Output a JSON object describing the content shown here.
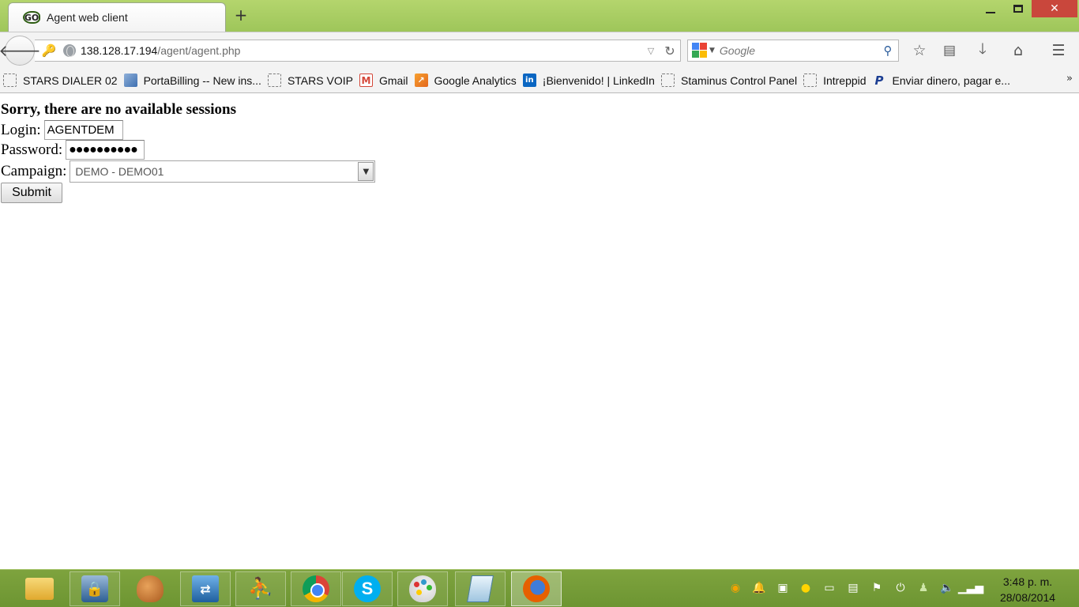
{
  "browser": {
    "tab_title": "Agent web client",
    "favicon_text": "GO",
    "new_tab_symbol": "+",
    "url_host": "138.128.17.194",
    "url_path": "/agent/agent.php",
    "search_placeholder": "Google",
    "window_close_symbol": "✕"
  },
  "bookmarks": [
    {
      "label": "STARS DIALER 02",
      "icon": "blank-page-icon"
    },
    {
      "label": "PortaBilling -- New ins...",
      "icon": "portabilling-icon"
    },
    {
      "label": "STARS VOIP",
      "icon": "blank-page-icon"
    },
    {
      "label": "Gmail",
      "icon": "gmail-icon"
    },
    {
      "label": "Google Analytics",
      "icon": "google-analytics-icon"
    },
    {
      "label": "¡Bienvenido! | LinkedIn",
      "icon": "linkedin-icon"
    },
    {
      "label": "Staminus Control Panel",
      "icon": "blank-page-icon"
    },
    {
      "label": "Intreppid",
      "icon": "blank-page-icon"
    },
    {
      "label": "Enviar dinero, pagar e...",
      "icon": "paypal-icon"
    }
  ],
  "page": {
    "message": "Sorry, there are no available sessions",
    "login_label": "Login:",
    "login_value": "AGENTDEM",
    "password_label": "Password:",
    "password_masked": "●●●●●●●●●●",
    "campaign_label": "Campaign:",
    "campaign_selected": "DEMO - DEMO01",
    "submit_label": "Submit"
  },
  "taskbar": {
    "apps": [
      "file-explorer",
      "security-lock-app",
      "baseball-mitt-app",
      "network-app",
      "people-app",
      "chrome",
      "skype",
      "paint",
      "notepad",
      "firefox"
    ],
    "active_app": "firefox",
    "time": "3:48 p. m.",
    "date": "28/08/2014"
  },
  "colors": {
    "titlebar": "#a9cd62",
    "taskbar": "#76a03a",
    "close_button": "#c9473c"
  }
}
